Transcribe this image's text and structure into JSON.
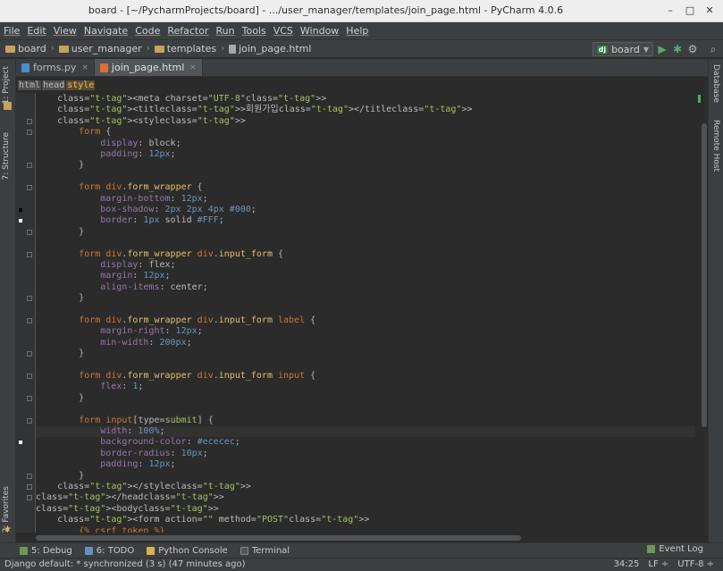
{
  "window": {
    "title": "board - [~/PycharmProjects/board] - .../user_manager/templates/join_page.html - PyCharm 4.0.6",
    "controls": [
      "–",
      "□",
      "✕"
    ]
  },
  "menu": [
    "File",
    "Edit",
    "View",
    "Navigate",
    "Code",
    "Refactor",
    "Run",
    "Tools",
    "VCS",
    "Window",
    "Help"
  ],
  "breadcrumbs": [
    "board",
    "user_manager",
    "templates",
    "join_page.html"
  ],
  "run_config": {
    "badge": "dj",
    "label": "board"
  },
  "left_tools": [
    "1: Project",
    "7: Structure",
    "2: Favorites"
  ],
  "right_tools": [
    "Database",
    "Remote Host"
  ],
  "tabs": [
    {
      "label": "forms.py",
      "close": "×",
      "active": false,
      "icon_color": "#4a8fcb"
    },
    {
      "label": "join_page.html",
      "close": "×",
      "active": true,
      "icon_color": "#e06c3a"
    }
  ],
  "tag_path": [
    "html",
    "head",
    "style"
  ],
  "code_lines": [
    "    <meta charset=\"UTF-8\">",
    "    <title>회원가입</title>",
    "    <style>",
    "        form {",
    "            display: block;",
    "            padding: 12px;",
    "        }",
    "",
    "        form div.form_wrapper {",
    "            margin-bottom: 12px;",
    "            box-shadow: 2px 2px 4px #000;",
    "            border: 1px solid #FFF;",
    "        }",
    "",
    "        form div.form_wrapper div.input_form {",
    "            display: flex;",
    "            margin: 12px;",
    "            align-items: center;",
    "        }",
    "",
    "        form div.form_wrapper div.input_form label {",
    "            margin-right: 12px;",
    "            min-width: 200px;",
    "        }",
    "",
    "        form div.form_wrapper div.input_form input {",
    "            flex: 1;",
    "        }",
    "",
    "        form input[type=submit] {",
    "            width: 100%;",
    "            background-color: #ececec;",
    "            border-radius: 10px;",
    "            padding: 12px;",
    "        }",
    "    </style>",
    "</head>",
    "<body>",
    "    <form action=\"\" method=\"POST\">",
    "        {% csrf_token %}"
  ],
  "tool_windows": [
    {
      "label": "5: Debug",
      "color": "#6a9955"
    },
    {
      "label": "6: TODO",
      "color": "#6a8fbf"
    },
    {
      "label": "Python Console",
      "color": "#d2b44a"
    },
    {
      "label": "Terminal",
      "color": "#555555"
    }
  ],
  "event_log": "Event Log",
  "status": {
    "message": "Django default: * synchronized (3 s) (47 minutes ago)",
    "position": "34:25",
    "line_sep": "LF ÷",
    "encoding": "UTF-8 ÷"
  }
}
